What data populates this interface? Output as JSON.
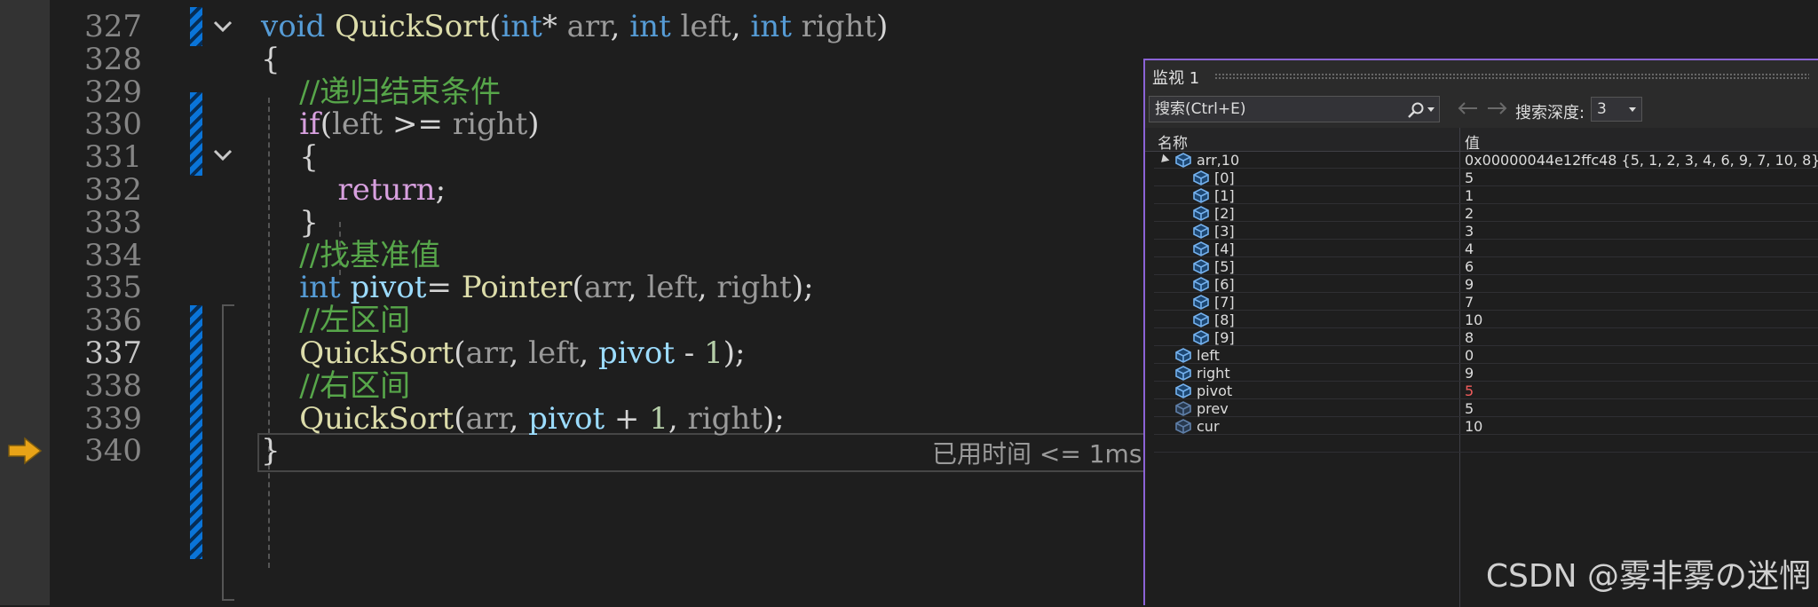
{
  "editor": {
    "lines": [
      {
        "num": "327",
        "tokens": [
          {
            "t": "void",
            "c": "kw"
          },
          {
            "t": " "
          },
          {
            "t": "QuickSort",
            "c": "fn"
          },
          {
            "t": "("
          },
          {
            "t": "int",
            "c": "kw"
          },
          {
            "t": "* "
          },
          {
            "t": "arr",
            "c": "param"
          },
          {
            "t": ", "
          },
          {
            "t": "int",
            "c": "kw"
          },
          {
            "t": " "
          },
          {
            "t": "left",
            "c": "param"
          },
          {
            "t": ", "
          },
          {
            "t": "int",
            "c": "kw"
          },
          {
            "t": " "
          },
          {
            "t": "right",
            "c": "param"
          },
          {
            "t": ")"
          }
        ]
      },
      {
        "num": "328",
        "tokens": [
          {
            "t": "{"
          }
        ]
      },
      {
        "num": "329",
        "tokens": [
          {
            "t": "    "
          },
          {
            "t": "//递归结束条件",
            "c": "cm"
          }
        ]
      },
      {
        "num": "330",
        "tokens": [
          {
            "t": "    "
          },
          {
            "t": "if",
            "c": "ctl"
          },
          {
            "t": "("
          },
          {
            "t": "left",
            "c": "param"
          },
          {
            "t": " >= "
          },
          {
            "t": "right",
            "c": "param"
          },
          {
            "t": ")"
          }
        ]
      },
      {
        "num": "331",
        "tokens": [
          {
            "t": "    {"
          }
        ]
      },
      {
        "num": "332",
        "tokens": [
          {
            "t": "        "
          },
          {
            "t": "return",
            "c": "ctl"
          },
          {
            "t": ";"
          }
        ]
      },
      {
        "num": "333",
        "tokens": [
          {
            "t": "    }"
          }
        ]
      },
      {
        "num": "334",
        "tokens": [
          {
            "t": "    "
          },
          {
            "t": "//找基准值",
            "c": "cm"
          }
        ]
      },
      {
        "num": "335",
        "tokens": [
          {
            "t": "    "
          },
          {
            "t": "int",
            "c": "kw"
          },
          {
            "t": " "
          },
          {
            "t": "pivot",
            "c": "var"
          },
          {
            "t": "= "
          },
          {
            "t": "Pointer",
            "c": "fn"
          },
          {
            "t": "("
          },
          {
            "t": "arr",
            "c": "param"
          },
          {
            "t": ", "
          },
          {
            "t": "left",
            "c": "param"
          },
          {
            "t": ", "
          },
          {
            "t": "right",
            "c": "param"
          },
          {
            "t": ");"
          }
        ]
      },
      {
        "num": "336",
        "tokens": [
          {
            "t": "    "
          },
          {
            "t": "//左区间",
            "c": "cm"
          }
        ]
      },
      {
        "num": "337",
        "tokens": [
          {
            "t": "    "
          },
          {
            "t": "QuickSort",
            "c": "fn"
          },
          {
            "t": "("
          },
          {
            "t": "arr",
            "c": "param"
          },
          {
            "t": ", "
          },
          {
            "t": "left",
            "c": "param"
          },
          {
            "t": ", "
          },
          {
            "t": "pivot",
            "c": "var"
          },
          {
            "t": " - "
          },
          {
            "t": "1",
            "c": "num"
          },
          {
            "t": ");"
          }
        ]
      },
      {
        "num": "338",
        "tokens": [
          {
            "t": "    "
          },
          {
            "t": "//右区间",
            "c": "cm"
          }
        ]
      },
      {
        "num": "339",
        "tokens": [
          {
            "t": "    "
          },
          {
            "t": "QuickSort",
            "c": "fn"
          },
          {
            "t": "("
          },
          {
            "t": "arr",
            "c": "param"
          },
          {
            "t": ", "
          },
          {
            "t": "pivot",
            "c": "var"
          },
          {
            "t": " + "
          },
          {
            "t": "1",
            "c": "num"
          },
          {
            "t": ", "
          },
          {
            "t": "right",
            "c": "param"
          },
          {
            "t": ");"
          }
        ]
      },
      {
        "num": "340",
        "tokens": [
          {
            "t": "}"
          }
        ]
      }
    ],
    "elapsed": "已用时间 <= 1ms"
  },
  "watch": {
    "title": "监视 1",
    "search_placeholder": "搜索(Ctrl+E)",
    "depth_label": "搜索深度:",
    "depth_value": "3",
    "col_name": "名称",
    "col_value": "值",
    "rows": [
      {
        "name": "arr,10",
        "value": "0x00000044e12ffc48 {5, 1, 2, 3, 4, 6, 9, 7, 10, 8}",
        "level": 0,
        "expanded": true,
        "icon": "array"
      },
      {
        "name": "[0]",
        "value": "5",
        "level": 1,
        "icon": "array"
      },
      {
        "name": "[1]",
        "value": "1",
        "level": 1,
        "icon": "array"
      },
      {
        "name": "[2]",
        "value": "2",
        "level": 1,
        "icon": "array"
      },
      {
        "name": "[3]",
        "value": "3",
        "level": 1,
        "icon": "array"
      },
      {
        "name": "[4]",
        "value": "4",
        "level": 1,
        "icon": "array"
      },
      {
        "name": "[5]",
        "value": "6",
        "level": 1,
        "icon": "array"
      },
      {
        "name": "[6]",
        "value": "9",
        "level": 1,
        "icon": "array"
      },
      {
        "name": "[7]",
        "value": "7",
        "level": 1,
        "icon": "array"
      },
      {
        "name": "[8]",
        "value": "10",
        "level": 1,
        "icon": "array"
      },
      {
        "name": "[9]",
        "value": "8",
        "level": 1,
        "icon": "array"
      },
      {
        "name": "left",
        "value": "0",
        "level": 0,
        "icon": "local"
      },
      {
        "name": "right",
        "value": "9",
        "level": 0,
        "icon": "local"
      },
      {
        "name": "pivot",
        "value": "5",
        "level": 0,
        "icon": "local",
        "changed": true
      },
      {
        "name": "prev",
        "value": "5",
        "level": 0,
        "icon": "stale"
      },
      {
        "name": "cur",
        "value": "10",
        "level": 0,
        "icon": "stale"
      }
    ]
  },
  "watermark": "CSDN @雾非雾の迷惘",
  "colors": {
    "keyword": "#569cd6",
    "control": "#d8a0df",
    "function": "#dcdcaa",
    "comment": "#57a64a",
    "variable": "#9cdcfe",
    "number": "#b5cea8",
    "watch_border": "#8b63d6",
    "changed_value": "#f05c5c",
    "change_bar": "#0a74d8"
  }
}
